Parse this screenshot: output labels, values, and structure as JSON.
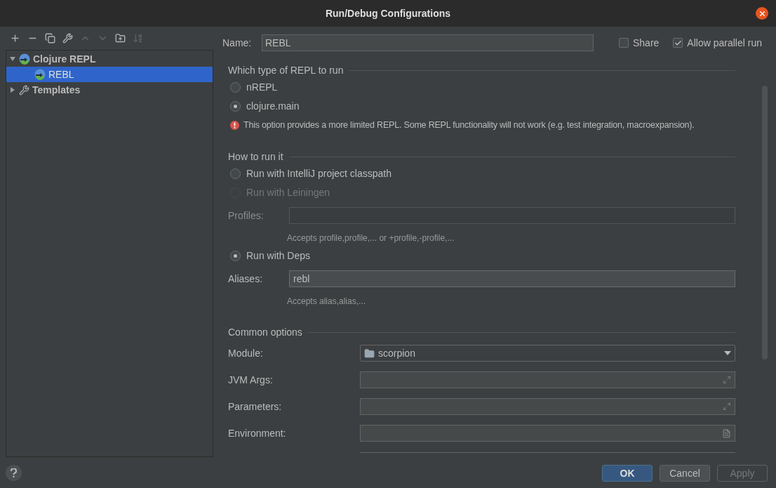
{
  "window": {
    "title": "Run/Debug Configurations"
  },
  "toolbar": [
    {
      "kind": "add",
      "disabled": false
    },
    {
      "kind": "remove",
      "disabled": false
    },
    {
      "kind": "copy",
      "disabled": false
    },
    {
      "kind": "wrench",
      "disabled": false
    },
    {
      "kind": "up",
      "disabled": true
    },
    {
      "kind": "down",
      "disabled": true
    },
    {
      "kind": "folder",
      "disabled": false
    },
    {
      "kind": "sort",
      "disabled": true
    }
  ],
  "tree": [
    {
      "label": "Clojure REPL",
      "kind": "repl",
      "expanded": true,
      "selected": false,
      "children": [
        {
          "label": "REBL",
          "kind": "repl",
          "selected": true
        }
      ]
    },
    {
      "label": "Templates",
      "kind": "wrench",
      "expanded": false,
      "selected": false
    }
  ],
  "name_field": {
    "label": "Name:",
    "value": "REBL"
  },
  "options": [
    {
      "label": "Share",
      "checked": false
    },
    {
      "label": "Allow parallel run",
      "checked": true
    }
  ],
  "repl_type": {
    "title": "Which type of REPL to run",
    "radios": [
      {
        "label": "nREPL",
        "selected": false
      },
      {
        "label": "clojure.main",
        "selected": true
      }
    ],
    "warning": "This option provides a more limited REPL. Some REPL functionality will not work (e.g. test integration, macroexpansion)."
  },
  "how_to_run": {
    "title": "How to run it",
    "items": [
      {
        "kind": "radio",
        "label": "Run with IntelliJ project classpath",
        "selected": false,
        "disabled": false
      },
      {
        "kind": "radio",
        "label": "Run with Leiningen",
        "selected": false,
        "disabled": true
      },
      {
        "kind": "field",
        "label": "Profiles:",
        "value": "",
        "disabled": true
      },
      {
        "kind": "hint",
        "text": "Accepts profile,profile,... or +profile,-profile,..."
      },
      {
        "kind": "radio",
        "label": "Run with Deps",
        "selected": true,
        "disabled": false
      },
      {
        "kind": "field",
        "label": "Aliases:",
        "value": "rebl",
        "disabled": false
      },
      {
        "kind": "hint",
        "text": "Accepts alias,alias,..."
      }
    ]
  },
  "common_options": {
    "title": "Common options",
    "fields": [
      {
        "label": "Module:",
        "kind": "dropdown",
        "value": "scorpion"
      },
      {
        "label": "JVM Args:",
        "kind": "expand"
      },
      {
        "label": "Parameters:",
        "kind": "expand"
      },
      {
        "label": "Environment:",
        "kind": "document"
      }
    ]
  },
  "buttons": [
    {
      "label": "OK",
      "kind": "primary",
      "disabled": false
    },
    {
      "label": "Cancel",
      "kind": "normal",
      "disabled": false
    },
    {
      "label": "Apply",
      "kind": "normal",
      "disabled": true
    }
  ]
}
